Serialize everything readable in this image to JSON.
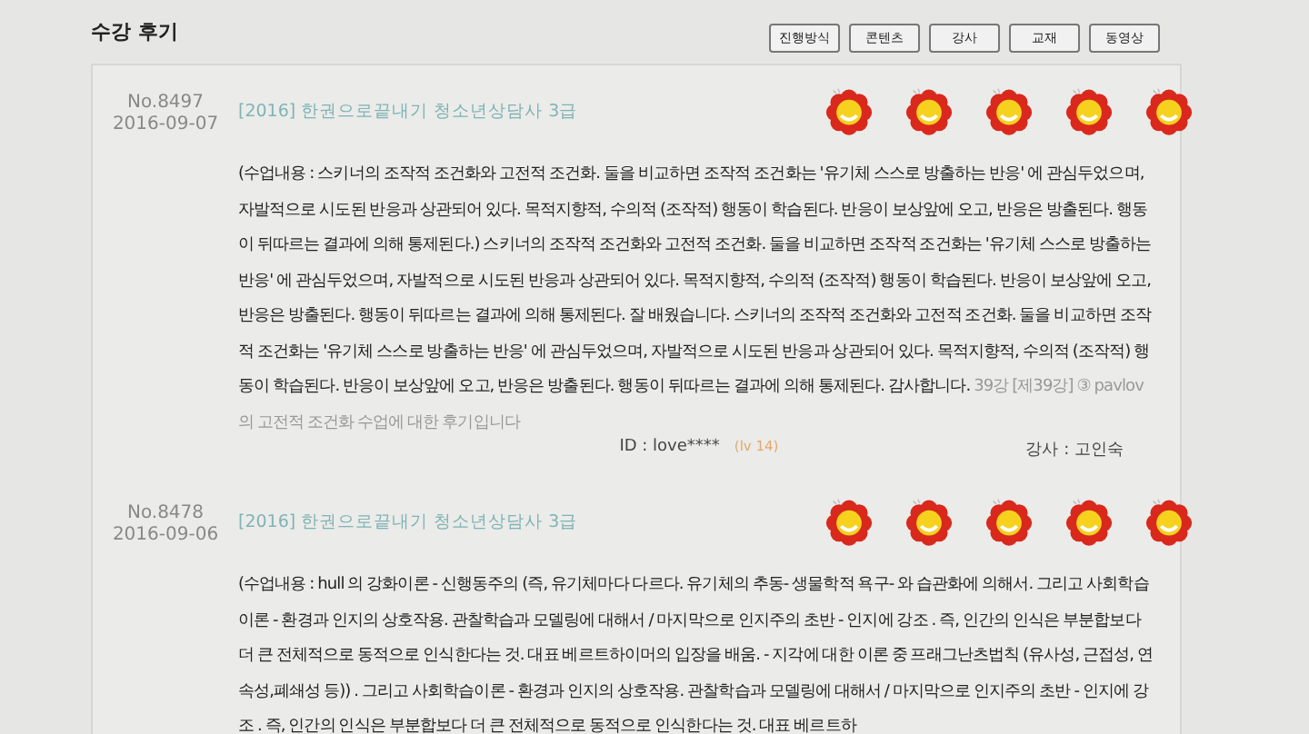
{
  "section_title": "수강 후기",
  "filter_buttons": [
    {
      "label": "진행방식"
    },
    {
      "label": "콘텐츠"
    },
    {
      "label": "강사"
    },
    {
      "label": "교재"
    },
    {
      "label": "동영상"
    }
  ],
  "reviews": [
    {
      "number": "No.8497",
      "date": "2016-09-07",
      "course": "[2016] 한권으로끝내기 청소년상담사 3급",
      "stars": 5,
      "body": "(수업내용 : 스키너의 조작적 조건화와 고전적 조건화. 둘을 비교하면 조작적 조건화는 '유기체 스스로 방출하는 반응' 에 관심두었으며, 자발적으로 시도된 반응과 상관되어 있다. 목적지향적, 수의적 (조작적) 행동이 학습된다. 반응이 보상앞에 오고, 반응은 방출된다. 행동이 뒤따르는 결과에 의해 통제된다.) 스키너의 조작적 조건화와 고전적 조건화. 둘을 비교하면 조작적 조건화는 '유기체 스스로 방출하는 반응' 에 관심두었으며, 자발적으로 시도된 반응과 상관되어 있다. 목적지향적, 수의적 (조작적) 행동이 학습된다. 반응이 보상앞에 오고, 반응은 방출된다. 행동이 뒤따르는 결과에 의해 통제된다. 잘 배웠습니다. 스키너의 조작적 조건화와 고전적 조건화. 둘을 비교하면 조작적 조건화는 '유기체 스스로 방출하는 반응' 에 관심두었으며, 자발적으로 시도된 반응과 상관되어 있다. 목적지향적, 수의적 (조작적) 행동이 학습된다. 반응이 보상앞에 오고, 반응은 방출된다. 행동이 뒤따르는 결과에 의해 통제된다. 감사합니다.",
      "lecture_note": "39강 [제39강] ③ pavlov의 고전적 조건화 수업에 대한 후기입니다",
      "user_id": "ID : love****",
      "user_level": "(lv 14)",
      "instructor": "강사 : 고인숙"
    },
    {
      "number": "No.8478",
      "date": "2016-09-06",
      "course": "[2016] 한권으로끝내기 청소년상담사 3급",
      "stars": 5,
      "body": "(수업내용 : hull 의 강화이론 - 신행동주의 (즉, 유기체마다 다르다. 유기체의 추동- 생물학적 욕구- 와 습관화에 의해서. 그리고 사회학습이론 - 환경과 인지의 상호작용. 관찰학습과 모델링에 대해서 / 마지막으로 인지주의 초반 - 인지에 강조 . 즉, 인간의 인식은 부분합보다 더 큰 전체적으로 동적으로 인식한다는 것. 대표 베르트하이머의 입장을 배움. - 지각에 대한 이론 중 프래그난츠법칙 (유사성, 근접성, 연속성,폐쇄성 등)) . 그리고 사회학습이론 - 환경과 인지의 상호작용. 관찰학습과 모델링에 대해서 / 마지막으로 인지주의 초반 - 인지에 강조 . 즉, 인간의 인식은 부분합보다 더 큰 전체적으로 동적으로 인식한다는 것. 대표 베르트하"
    }
  ]
}
